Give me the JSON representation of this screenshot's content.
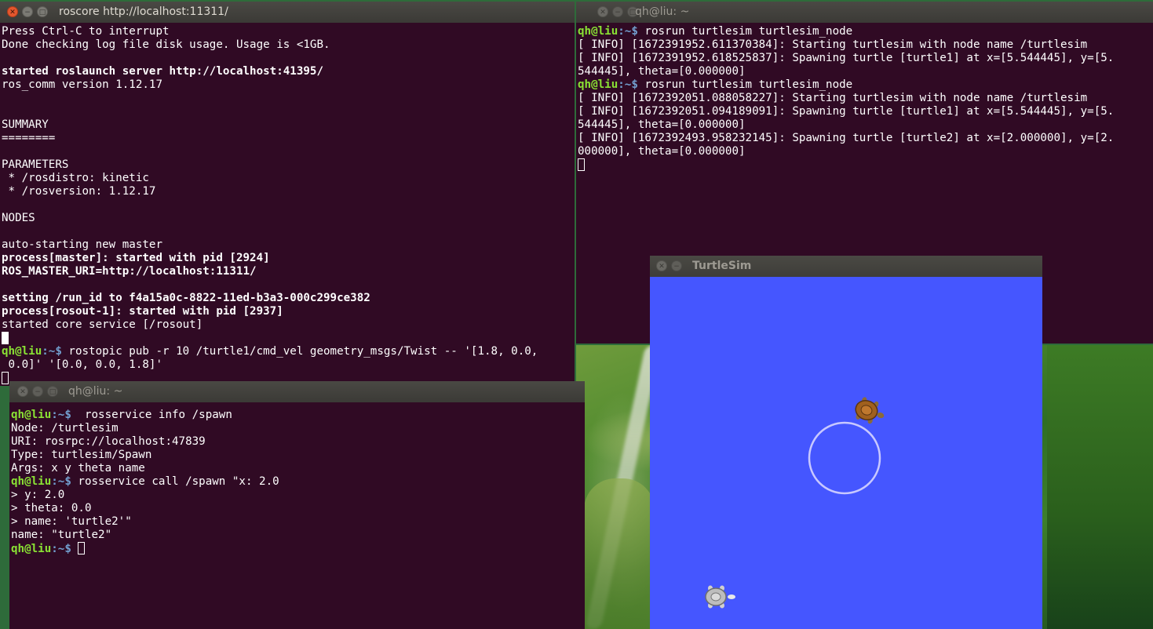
{
  "desktop": {
    "wallpaper": "green terraced hills landscape"
  },
  "win_roscore": {
    "title": "roscore http://localhost:11311/",
    "lines": [
      "Press Ctrl-C to interrupt",
      "Done checking log file disk usage. Usage is <1GB.",
      "",
      "started roslaunch server http://localhost:41395/",
      "ros_comm version 1.12.17",
      "",
      "",
      "SUMMARY",
      "========",
      "",
      "PARAMETERS",
      " * /rosdistro: kinetic",
      " * /rosversion: 1.12.17",
      "",
      "NODES",
      "",
      "auto-starting new master",
      "process[master]: started with pid [2924]",
      "ROS_MASTER_URI=http://localhost:11311/",
      "",
      "setting /run_id to f4a15a0c-8822-11ed-b3a3-000c299ce382",
      "process[rosout-1]: started with pid [2937]",
      "started core service [/rosout]"
    ],
    "pub_prompt_user": "qh@liu",
    "pub_prompt_path": ":~$",
    "pub_command_1": " rostopic pub -r 10 /turtle1/cmd_vel geometry_msgs/Twist -- '[1.8, 0.0,",
    "pub_command_2": " 0.0]' '[0.0, 0.0, 1.8]'"
  },
  "win_turtlesim_node": {
    "title": "qh@liu: ~",
    "prompt_user": "qh@liu",
    "prompt_path": ":~$",
    "command": " rosrun turtlesim turtlesim_node",
    "lines_1": [
      "[ INFO] [1672391952.611370384]: Starting turtlesim with node name /turtlesim",
      "[ INFO] [1672391952.618525837]: Spawning turtle [turtle1] at x=[5.544445], y=[5.",
      "544445], theta=[0.000000]"
    ],
    "lines_2": [
      "[ INFO] [1672392051.088058227]: Starting turtlesim with node name /turtlesim",
      "[ INFO] [1672392051.094189091]: Spawning turtle [turtle1] at x=[5.544445], y=[5.",
      "544445], theta=[0.000000]",
      "[ INFO] [1672392493.958232145]: Spawning turtle [turtle2] at x=[2.000000], y=[2.",
      "000000], theta=[0.000000]"
    ]
  },
  "win_rosservice": {
    "title": "qh@liu: ~",
    "prompt_user": "qh@liu",
    "prompt_path": ":~$",
    "cmd_info": "  rosservice info /spawn",
    "info_lines": [
      "Node: /turtlesim",
      "URI: rosrpc://localhost:47839",
      "Type: turtlesim/Spawn",
      "Args: x y theta name"
    ],
    "cmd_call": " rosservice call /spawn \"x: 2.0",
    "call_lines": [
      "> y: 2.0",
      "> theta: 0.0",
      "> name: 'turtle2'\"",
      "name: \"turtle2\""
    ],
    "final_prompt_tail": " "
  },
  "win_turtlesim_gui": {
    "title": "TurtleSim",
    "background": "#4556ff",
    "path_color": "#c8c8ff"
  },
  "colors": {
    "terminal_bg": "#300a24",
    "prompt_green": "#8ae234",
    "prompt_blue": "#729fcf",
    "titlebar": "#3b3a36"
  }
}
